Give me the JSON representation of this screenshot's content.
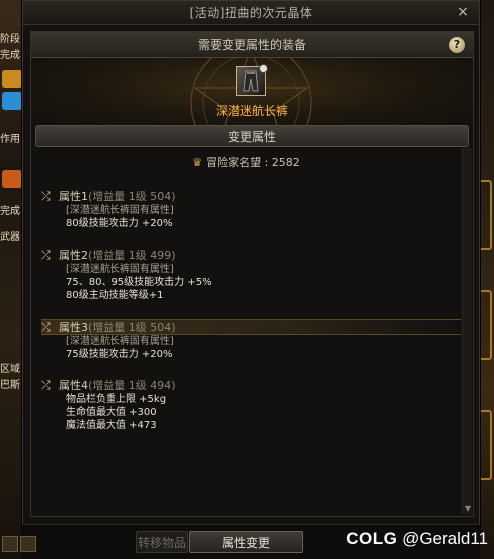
{
  "window": {
    "title": "[活动]扭曲的次元晶体",
    "close_glyph": "×"
  },
  "equip_section": {
    "header": "需要变更属性的装备",
    "help_glyph": "?",
    "item_name": "深潜迷航长裤"
  },
  "change_section": {
    "header": "变更属性"
  },
  "renown": {
    "label": "冒险家名望 : 2582"
  },
  "attributes": [
    {
      "head": "属性1",
      "gain": "(增益量 1级 504)",
      "fixed": "[深潜迷航长裤固有属性]",
      "lines": [
        "80级技能攻击力 +20%"
      ]
    },
    {
      "head": "属性2",
      "gain": "(增益量 1级 499)",
      "fixed": "[深潜迷航长裤固有属性]",
      "lines": [
        "75、80、95级技能攻击力 +5%",
        "80级主动技能等级+1"
      ]
    },
    {
      "head": "属性3",
      "gain": "(增益量 1级 504)",
      "fixed": "[深潜迷航长裤固有属性]",
      "lines": [
        "75级技能攻击力 +20%"
      ]
    },
    {
      "head": "属性4",
      "gain": "(增益量 1级 494)",
      "fixed": "",
      "lines": [
        "物品栏负重上限 +5kg",
        "生命值最大值 +300",
        "魔法值最大值 +473"
      ]
    }
  ],
  "buttons": {
    "transfer": "转移物品",
    "change": "属性变更"
  },
  "watermark": {
    "brand": "COLG",
    "user": "@Gerald11"
  },
  "left_bg_snippets": [
    "阶段",
    "完成",
    "作用",
    "完成",
    "武器",
    "区域",
    "巴斯"
  ],
  "colors": {
    "item_name": "#ffb347",
    "selected_row": "#3b2f1b",
    "accent_gold": "#d7a84a"
  }
}
